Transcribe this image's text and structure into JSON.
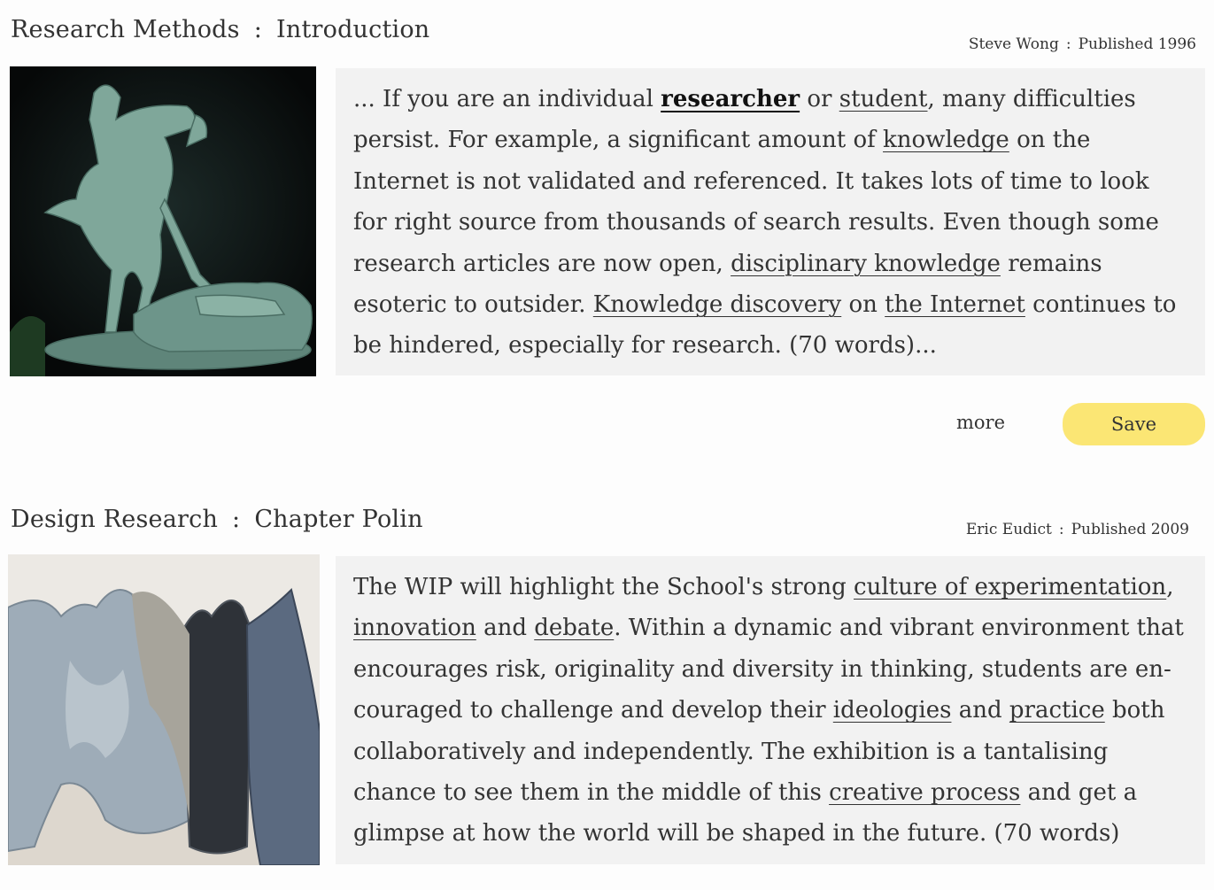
{
  "entries": [
    {
      "book": "Research Methods",
      "chapter": "Introduction",
      "author": "Steve Wong",
      "published": "Published 1996",
      "excerpt": {
        "t1": "... If you are an individual ",
        "k1": "researcher",
        "t2": " or ",
        "k2": "student",
        "t3": ", many difficulties persist. For example, a significant amount of ",
        "k3": "knowledge",
        "t4": " on the Internet is not validated and referenced. It takes lots of time to look for right source from thousands of search results. Even though some research articles are now open, ",
        "k4": "disciplinary knowledge",
        "t5": " remains esoteric to outsider. ",
        "k5": "Knowledge discovery",
        "t6": " on ",
        "k6": "the Internet",
        "t7": " continues to be hindered, especially for research. (70 words)..."
      },
      "more_label": "more",
      "save_label": "Save"
    },
    {
      "book": "Design Research",
      "chapter": "Chapter Polin",
      "author": "Eric Eudict",
      "published": "Published 2009",
      "excerpt": {
        "t1": "The WIP will highlight the School's strong ",
        "k1": "culture of experimentation",
        "t2": ", ",
        "k2": "innovation",
        "t3": " and ",
        "k3": "debate",
        "t4": ". Within a dynamic and vibrant environment that encourages risk, originality and diversity in thinking, students are en-couraged to challenge and develop their ",
        "k4": "ideologies",
        "t5": " and ",
        "k5": "practice",
        "t6": " both collaboratively and independently. The exhibition is a tantalising chance to see them in the middle of this ",
        "k6": "creative process",
        "t7": " and get a glimpse at how the world will be shaped in the future. (70 words)"
      }
    }
  ],
  "separator": ":",
  "colors": {
    "excerpt_bg": "#f2f2f2",
    "save_bg": "#fbe674",
    "text": "#333333"
  }
}
